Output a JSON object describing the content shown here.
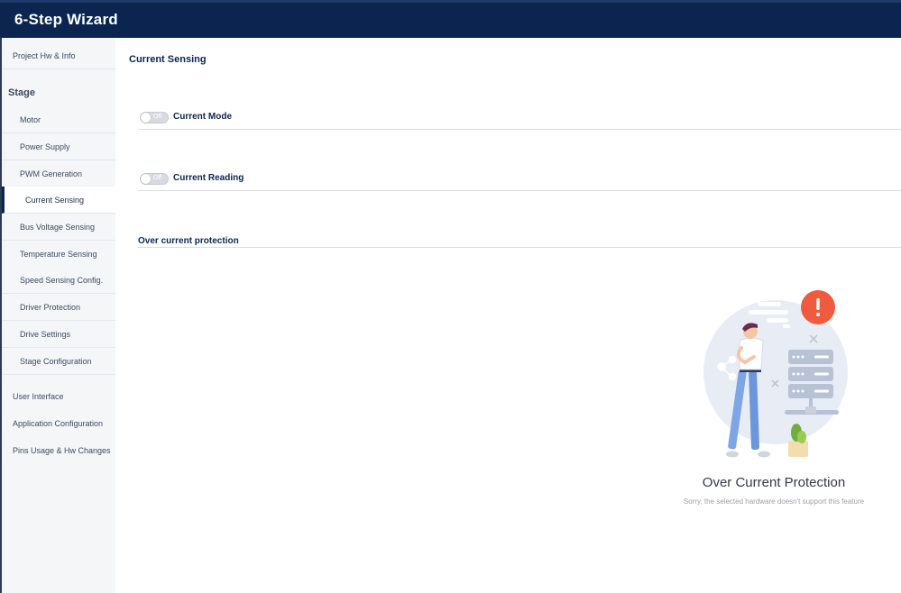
{
  "header": {
    "title": "6-Step Wizard"
  },
  "sidebar": {
    "top_items": [
      {
        "label": "Project Hw & Info"
      }
    ],
    "stage_label": "Stage",
    "stage_items": [
      {
        "label": "Motor"
      },
      {
        "label": "Power Supply"
      },
      {
        "label": "PWM Generation"
      },
      {
        "label": "Current Sensing"
      },
      {
        "label": "Bus Voltage Sensing"
      },
      {
        "label": "Temperature Sensing"
      },
      {
        "label": "Speed Sensing Config."
      },
      {
        "label": "Driver Protection"
      },
      {
        "label": "Drive Settings"
      },
      {
        "label": "Stage Configuration"
      }
    ],
    "bottom_items": [
      {
        "label": "User Interface"
      },
      {
        "label": "Application Configuration"
      },
      {
        "label": "Pins Usage & Hw Changes"
      }
    ],
    "active": "Current Sensing"
  },
  "main": {
    "title": "Current Sensing",
    "toggles": [
      {
        "label": "Current Mode",
        "state": "Off"
      },
      {
        "label": "Current Reading",
        "state": "Off"
      }
    ],
    "section": "Over current protection",
    "empty_state": {
      "title": "Over Current Protection",
      "message": "Sorry, the selected hardware doesn't support this feature",
      "badge": "!"
    }
  },
  "colors": {
    "header_bg": "#0b2550",
    "sidebar_bg": "#f5f6f8",
    "alert_red": "#f05a3e",
    "circle_bg": "#e8ecf5"
  },
  "icons": [
    "exclamation-badge-icon",
    "server-rack-icon",
    "share-icon",
    "plant-icon",
    "person-thinking-illustration"
  ]
}
